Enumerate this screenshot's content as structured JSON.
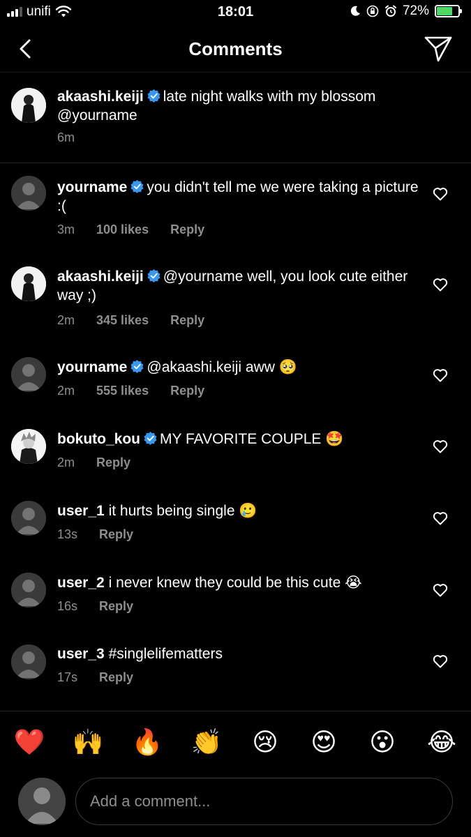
{
  "status_bar": {
    "carrier": "unifi",
    "time": "18:01",
    "battery": "72%"
  },
  "header": {
    "title": "Comments"
  },
  "caption": {
    "username": "akaashi.keiji",
    "text": "late night walks with my blossom @yourname",
    "time": "6m"
  },
  "comments": [
    {
      "username": "yourname",
      "text": "you didn't tell me we were taking a picture :(",
      "time": "3m",
      "likes": "100 likes",
      "reply": "Reply"
    },
    {
      "username": "akaashi.keiji",
      "text": "@yourname well, you look cute either way ;)",
      "time": "2m",
      "likes": "345 likes",
      "reply": "Reply"
    },
    {
      "username": "yourname",
      "text": "@akaashi.keiji aww 🥺",
      "time": "2m",
      "likes": "555 likes",
      "reply": "Reply"
    },
    {
      "username": "bokuto_kou",
      "text": "MY FAVORITE COUPLE 🤩",
      "time": "2m",
      "reply": "Reply"
    },
    {
      "username": "user_1",
      "text": "it hurts being single 🥲",
      "time": "13s",
      "reply": "Reply"
    },
    {
      "username": "user_2",
      "text": "i never knew they could be this cute 😭",
      "time": "16s",
      "reply": "Reply"
    },
    {
      "username": "user_3",
      "text": "#singlelifematters",
      "time": "17s",
      "reply": "Reply"
    }
  ],
  "emoji_bar": [
    "❤️",
    "🙌",
    "🔥",
    "👏",
    "😢",
    "😍",
    "😮",
    "😂"
  ],
  "comment_box": {
    "placeholder": "Add a comment..."
  },
  "colors": {
    "background": "#000000",
    "secondary_text": "#8e8e8e",
    "verified": "#3897f0",
    "battery": "#4cd964"
  }
}
